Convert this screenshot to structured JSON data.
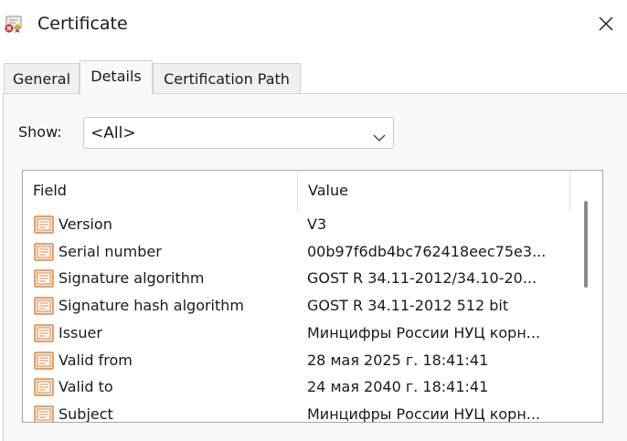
{
  "window": {
    "title": "Certificate",
    "app_icon": "certificate-error-icon",
    "close_icon": "close-icon"
  },
  "tabs": [
    {
      "label": "General",
      "active": false
    },
    {
      "label": "Details",
      "active": true
    },
    {
      "label": "Certification Path",
      "active": false
    }
  ],
  "show": {
    "label": "Show:",
    "selected": "<All>",
    "icon": "chevron-down-icon"
  },
  "list": {
    "columns": [
      "Field",
      "Value"
    ],
    "row_icon": "certificate-field-icon",
    "rows": [
      {
        "field": "Version",
        "value": "V3"
      },
      {
        "field": "Serial number",
        "value": "00b97f6db4bc762418eec75e3..."
      },
      {
        "field": "Signature algorithm",
        "value": "GOST R 34.11-2012/34.10-20..."
      },
      {
        "field": "Signature hash algorithm",
        "value": "GOST R 34.11-2012 512 bit"
      },
      {
        "field": "Issuer",
        "value": "Минцифры России НУЦ корн..."
      },
      {
        "field": "Valid from",
        "value": "28 мая 2025 г. 18:41:41"
      },
      {
        "field": "Valid to",
        "value": "24 мая 2040 г. 18:41:41"
      },
      {
        "field": "Subject",
        "value": "Минцифры России НУЦ корн..."
      }
    ]
  },
  "colors": {
    "icon_orange": "#d8884a",
    "icon_fill": "#fbe6cf",
    "error_red": "#d33a2c"
  }
}
